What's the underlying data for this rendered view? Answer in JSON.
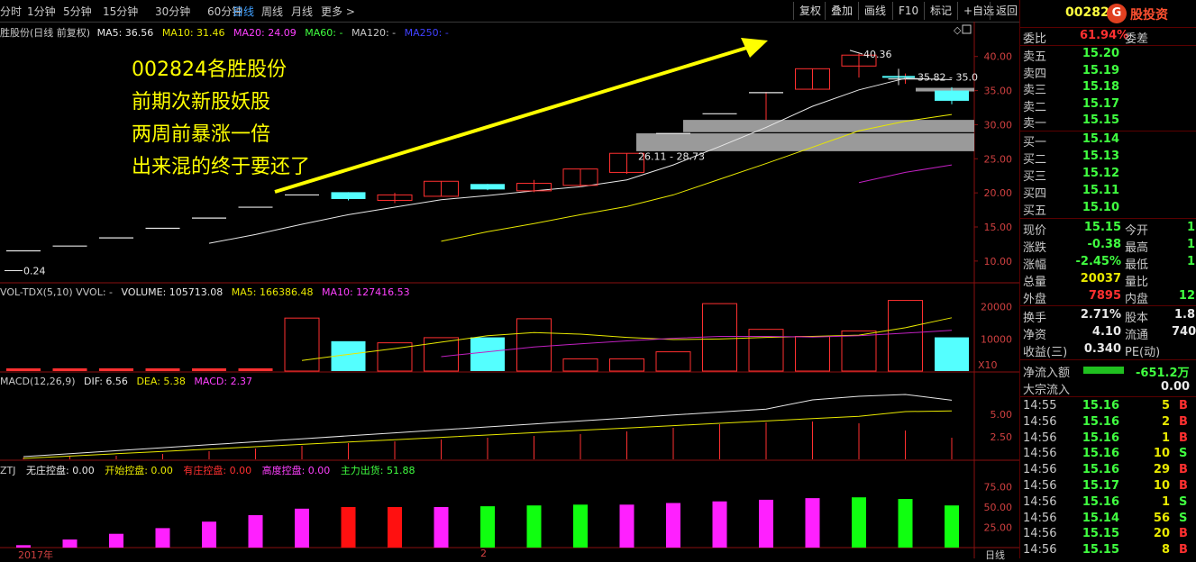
{
  "toolbar": {
    "periods": [
      "分时",
      "1分钟",
      "5分钟",
      "15分钟",
      "30分钟",
      "60分钟",
      "日线",
      "周线",
      "月线",
      "更多 >"
    ],
    "active_period": "日线",
    "buttons": [
      "复权",
      "叠加",
      "画线",
      "F10",
      "标记",
      "+自选",
      "返回"
    ]
  },
  "price_panel": {
    "header_name": "胜股份(日线 前复权)",
    "ma5": "MA5: 36.56",
    "ma10": "MA10: 31.46",
    "ma20": "MA20: 24.09",
    "ma60": "MA60: -",
    "ma120": "MA120: -",
    "ma250": "MA250: -",
    "high_label": "40.36",
    "low_label": "0.24",
    "range_label_1": "35.82 - 35.0",
    "range_label_2": "26.11 - 28.73",
    "y_ticks": [
      "40.00",
      "35.00",
      "30.00",
      "25.00",
      "20.00",
      "15.00",
      "10.00"
    ]
  },
  "annotation": {
    "lines": [
      "002824各胜股份",
      "前期次新股妖股",
      "两周前暴涨一倍",
      "出来混的终于要还了"
    ]
  },
  "volume_panel": {
    "name": "VOL-TDX(5,10) VVOL: -",
    "volume": "VOLUME: 105713.08",
    "ma5": "MA5: 166386.48",
    "ma10": "MA10: 127416.53",
    "y_ticks": [
      "20000",
      "10000"
    ],
    "unit": "X10"
  },
  "macd_panel": {
    "name": "MACD(12,26,9)",
    "dif": "DIF: 6.56",
    "dea": "DEA: 5.38",
    "macd": "MACD: 2.37",
    "y_ticks": [
      "5.00",
      "2.50"
    ]
  },
  "ztj_panel": {
    "name": "ZTJ",
    "f1": "无庄控盘: 0.00",
    "f2": "开始控盘: 0.00",
    "f3": "有庄控盘: 0.00",
    "f4": "高度控盘: 0.00",
    "f5": "主力出货: 51.88",
    "y_ticks": [
      "75.00",
      "50.00",
      "25.00"
    ]
  },
  "x_axis": {
    "left": "2017年",
    "mid": "2",
    "right_tab": "日线"
  },
  "quote": {
    "code": "00282",
    "brand": "股投资",
    "wb_label": "委比",
    "wb_value": "61.94%",
    "wc_label": "委差",
    "asks": [
      {
        "label": "卖五",
        "price": "15.20"
      },
      {
        "label": "卖四",
        "price": "15.19"
      },
      {
        "label": "卖三",
        "price": "15.18"
      },
      {
        "label": "卖二",
        "price": "15.17"
      },
      {
        "label": "卖一",
        "price": "15.15"
      }
    ],
    "bids": [
      {
        "label": "买一",
        "price": "15.14"
      },
      {
        "label": "买二",
        "price": "15.13"
      },
      {
        "label": "买三",
        "price": "15.12"
      },
      {
        "label": "买四",
        "price": "15.11"
      },
      {
        "label": "买五",
        "price": "15.10"
      }
    ],
    "stats": [
      {
        "l1": "现价",
        "v1": "15.15",
        "l2": "今开",
        "v2": "1"
      },
      {
        "l1": "涨跌",
        "v1": "-0.38",
        "l2": "最高",
        "v2": "1"
      },
      {
        "l1": "涨幅",
        "v1": "-2.45%",
        "l2": "最低",
        "v2": "1"
      },
      {
        "l1": "总量",
        "v1": "20037",
        "l2": "量比",
        "v2": ""
      },
      {
        "l1": "外盘",
        "v1": "7895",
        "l2": "内盘",
        "v2": "12"
      }
    ],
    "stats2": [
      {
        "l1": "换手",
        "v1": "2.71%",
        "l2": "股本",
        "v2": "1.8"
      },
      {
        "l1": "净资",
        "v1": "4.10",
        "l2": "流通",
        "v2": "740"
      },
      {
        "l1": "收益(三)",
        "v1": "0.340",
        "l2": "PE(动)",
        "v2": ""
      }
    ],
    "netflow_label": "净流入额",
    "netflow_value": "-651.2万",
    "bigflow_label": "大宗流入",
    "bigflow_value": "0.00",
    "ticks": [
      {
        "time": "14:55",
        "price": "15.16",
        "vol": "5",
        "side": "B"
      },
      {
        "time": "14:56",
        "price": "15.16",
        "vol": "2",
        "side": "B"
      },
      {
        "time": "14:56",
        "price": "15.16",
        "vol": "1",
        "side": "B"
      },
      {
        "time": "14:56",
        "price": "15.16",
        "vol": "10",
        "side": "S"
      },
      {
        "time": "14:56",
        "price": "15.16",
        "vol": "29",
        "side": "B"
      },
      {
        "time": "14:56",
        "price": "15.17",
        "vol": "10",
        "side": "B"
      },
      {
        "time": "14:56",
        "price": "15.16",
        "vol": "1",
        "side": "S"
      },
      {
        "time": "14:56",
        "price": "15.14",
        "vol": "56",
        "side": "S"
      },
      {
        "time": "14:56",
        "price": "15.15",
        "vol": "20",
        "side": "B"
      },
      {
        "time": "14:56",
        "price": "15.15",
        "vol": "8",
        "side": "B"
      }
    ]
  },
  "chart_data": {
    "type": "candlestick",
    "candles": [
      {
        "o": 11.5,
        "c": 11.5,
        "h": 11.5,
        "l": 11.5
      },
      {
        "o": 12.2,
        "c": 12.2,
        "h": 12.2,
        "l": 12.2
      },
      {
        "o": 13.4,
        "c": 13.4,
        "h": 13.4,
        "l": 13.4
      },
      {
        "o": 14.8,
        "c": 14.8,
        "h": 14.8,
        "l": 14.8
      },
      {
        "o": 16.3,
        "c": 16.3,
        "h": 16.3,
        "l": 16.3
      },
      {
        "o": 17.9,
        "c": 17.9,
        "h": 17.9,
        "l": 17.9
      },
      {
        "o": 19.7,
        "c": 19.7,
        "h": 19.7,
        "l": 19.7
      },
      {
        "o": 20.1,
        "c": 19.1,
        "h": 20.1,
        "l": 18.9
      },
      {
        "o": 18.9,
        "c": 19.7,
        "h": 20.0,
        "l": 18.5
      },
      {
        "o": 19.5,
        "c": 21.7,
        "h": 21.7,
        "l": 19.5
      },
      {
        "o": 21.3,
        "c": 20.5,
        "h": 21.3,
        "l": 20.4
      },
      {
        "o": 20.3,
        "c": 21.4,
        "h": 21.9,
        "l": 20.1
      },
      {
        "o": 21.1,
        "c": 23.5,
        "h": 23.5,
        "l": 20.9
      },
      {
        "o": 23.0,
        "c": 25.8,
        "h": 25.8,
        "l": 22.8
      },
      {
        "o": 28.7,
        "c": 28.7,
        "h": 28.7,
        "l": 28.7
      },
      {
        "o": 31.6,
        "c": 31.6,
        "h": 31.6,
        "l": 31.6
      },
      {
        "o": 34.7,
        "c": 34.7,
        "h": 34.8,
        "l": 30.7
      },
      {
        "o": 35.2,
        "c": 38.2,
        "h": 38.2,
        "l": 35.2
      },
      {
        "o": 38.6,
        "c": 40.2,
        "h": 40.4,
        "l": 36.9
      },
      {
        "o": 36.7,
        "c": 36.7,
        "h": 37.5,
        "l": 36.0
      },
      {
        "o": 35.0,
        "c": 33.5,
        "h": 35.5,
        "l": 33.0
      }
    ],
    "volume": [
      0,
      0,
      0,
      0,
      0,
      0,
      16500,
      9300,
      8800,
      10400,
      10500,
      16300,
      3800,
      3800,
      6000,
      21000,
      13000,
      10800,
      12500,
      22000,
      10500
    ],
    "macd_bars": [
      0.2,
      0.3,
      0.4,
      0.6,
      0.9,
      1.2,
      1.5,
      1.8,
      2.0,
      2.2,
      2.4,
      2.6,
      2.8,
      3.1,
      3.5,
      3.9,
      4.1,
      4.2,
      4.0,
      3.2,
      2.4
    ],
    "ztj_values": [
      3,
      10,
      17,
      24,
      32,
      40,
      48,
      50,
      50,
      50,
      51,
      52,
      53,
      53,
      55,
      57,
      59,
      61,
      62,
      60,
      52
    ],
    "ztj_colors": [
      "m",
      "m",
      "m",
      "m",
      "m",
      "m",
      "m",
      "r",
      "r",
      "m",
      "g",
      "g",
      "g",
      "m",
      "m",
      "m",
      "m",
      "m",
      "g",
      "g",
      "g"
    ],
    "ylim_price": [
      8,
      43
    ],
    "ylim_volume": [
      0,
      23000
    ],
    "ylim_macd": [
      0,
      8
    ],
    "ylim_ztj": [
      0,
      90
    ]
  }
}
